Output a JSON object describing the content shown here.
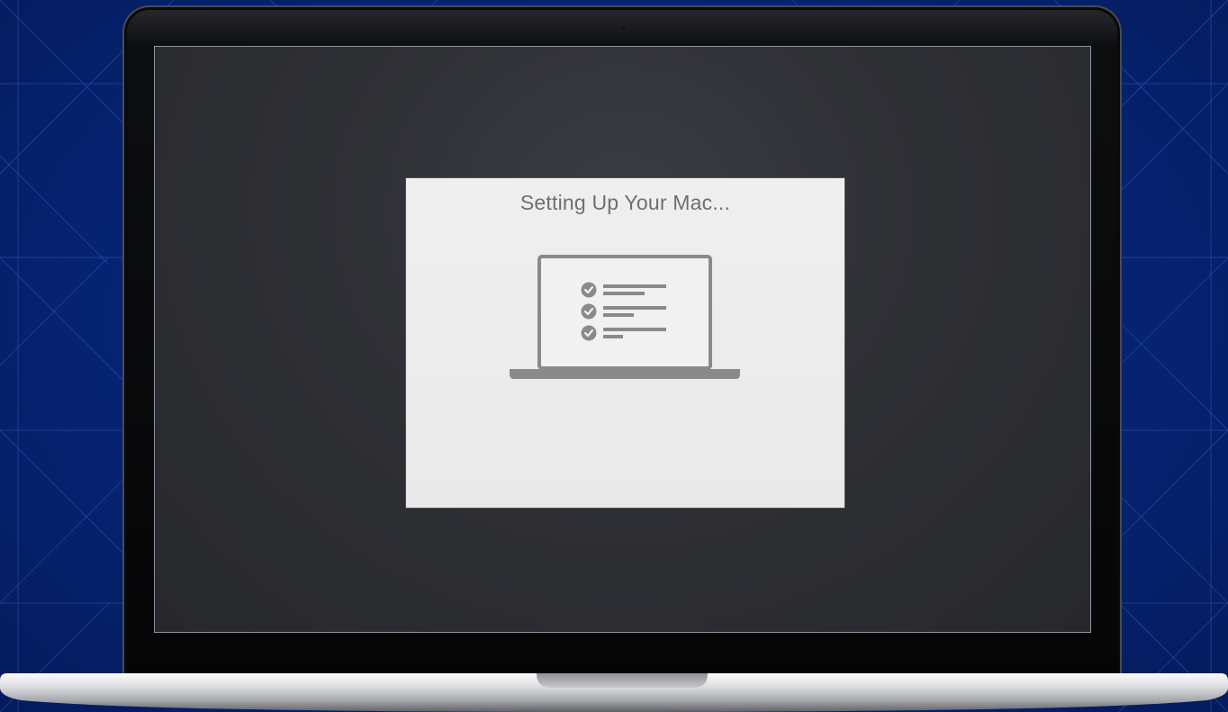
{
  "dialog": {
    "title": "Setting Up Your Mac..."
  },
  "illustration": {
    "icon": "laptop-checklist-icon",
    "checklist_items": [
      {
        "checked": true
      },
      {
        "checked": true
      },
      {
        "checked": true
      }
    ]
  },
  "colors": {
    "background": "#062475",
    "screen": "#2f3035",
    "dialog": "#efefef",
    "dialog_text": "#6f6f72",
    "icon_gray": "#8a8a8c"
  }
}
